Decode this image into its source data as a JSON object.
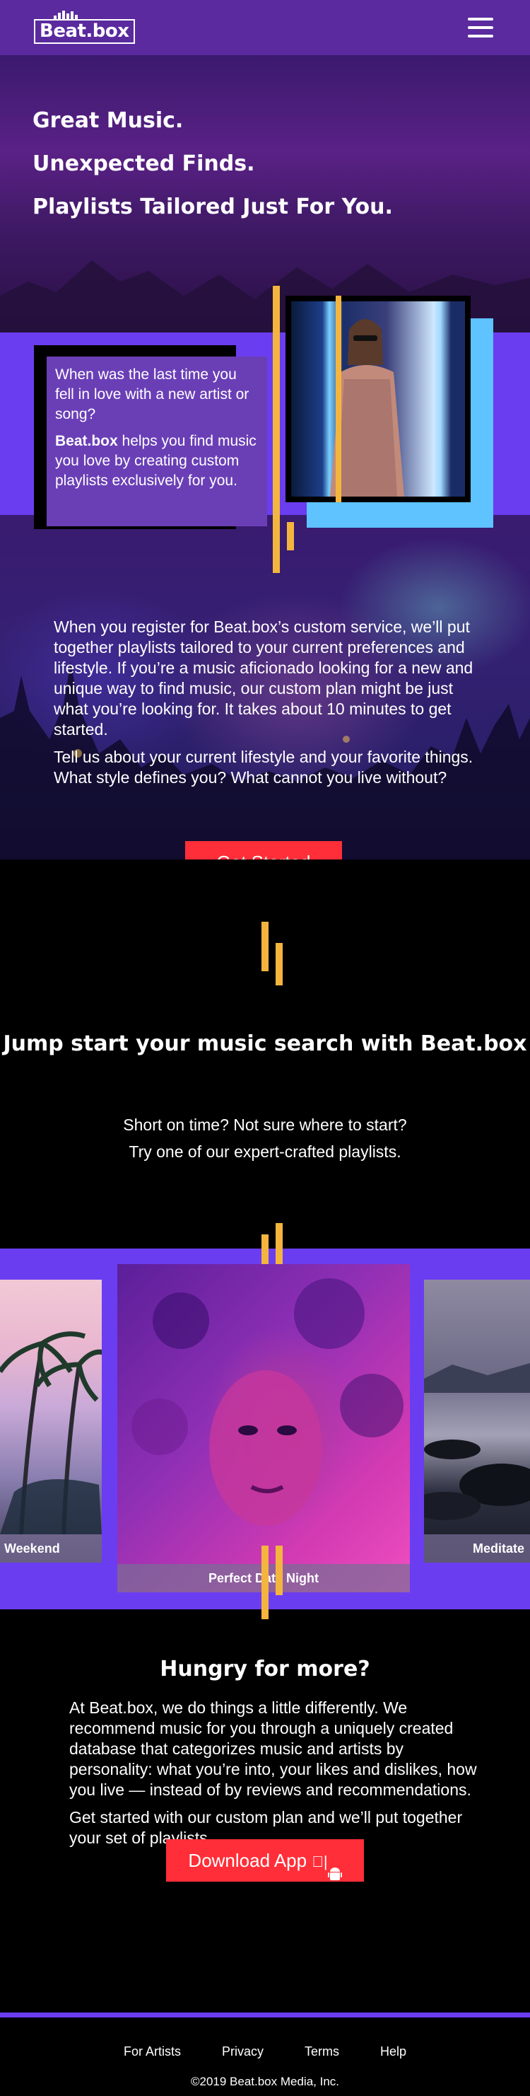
{
  "brand": {
    "logo_text": "Beat.box"
  },
  "hero": {
    "headlines": [
      "Great Music.",
      "Unexpected Finds.",
      "Playlists Tailored Just For You."
    ],
    "box_question": "When was the last time you fell in love with a new artist or song?",
    "box_brand": "Beat.box",
    "box_rest": " helps you find music you love by creating custom playlists exclusively for you.",
    "body_1": "When you register for Beat.box’s custom service, we’ll put together playlists tailored to your current preferences and lifestyle. If you’re a music aficionado looking for a new and unique way to find music, our custom plan might be just what you’re looking for. It takes about 10 minutes to get started.",
    "body_2": "Tell us about your current lifestyle and your favorite things. What style defines you? What cannot you live without?",
    "cta": "Get Started"
  },
  "jumpstart": {
    "title": "Jump start your music search with Beat.box",
    "line_1": "Short on time? Not sure where to start?",
    "line_2": "Try one of our expert-crafted playlists."
  },
  "playlists": [
    {
      "label": "Weekend"
    },
    {
      "label": "Perfect Date Night"
    },
    {
      "label": "Meditate"
    }
  ],
  "more": {
    "title": "Hungry for more?",
    "body_1": "At Beat.box, we do things a little differently. We recommend music for you through a uniquely created database that categorizes music and artists by personality: what you’re into, your likes and dislikes, how you live — instead of by reviews and recommendations.",
    "body_2": "Get started with our custom plan and we’ll put together your set of playlists.",
    "cta": "Download App"
  },
  "footer": {
    "links": [
      "For Artists",
      "Privacy",
      "Terms",
      "Help"
    ],
    "copyright": "©2019 Beat.box Media, Inc."
  },
  "colors": {
    "nav": "#5a2a9e",
    "band": "#6b3df0",
    "accent_red": "#ff2e38",
    "accent_yellow": "#f4b53f",
    "accent_blue": "#5ec3ff"
  },
  "icons": [
    "menu-icon",
    "apple-icon",
    "android-icon"
  ]
}
